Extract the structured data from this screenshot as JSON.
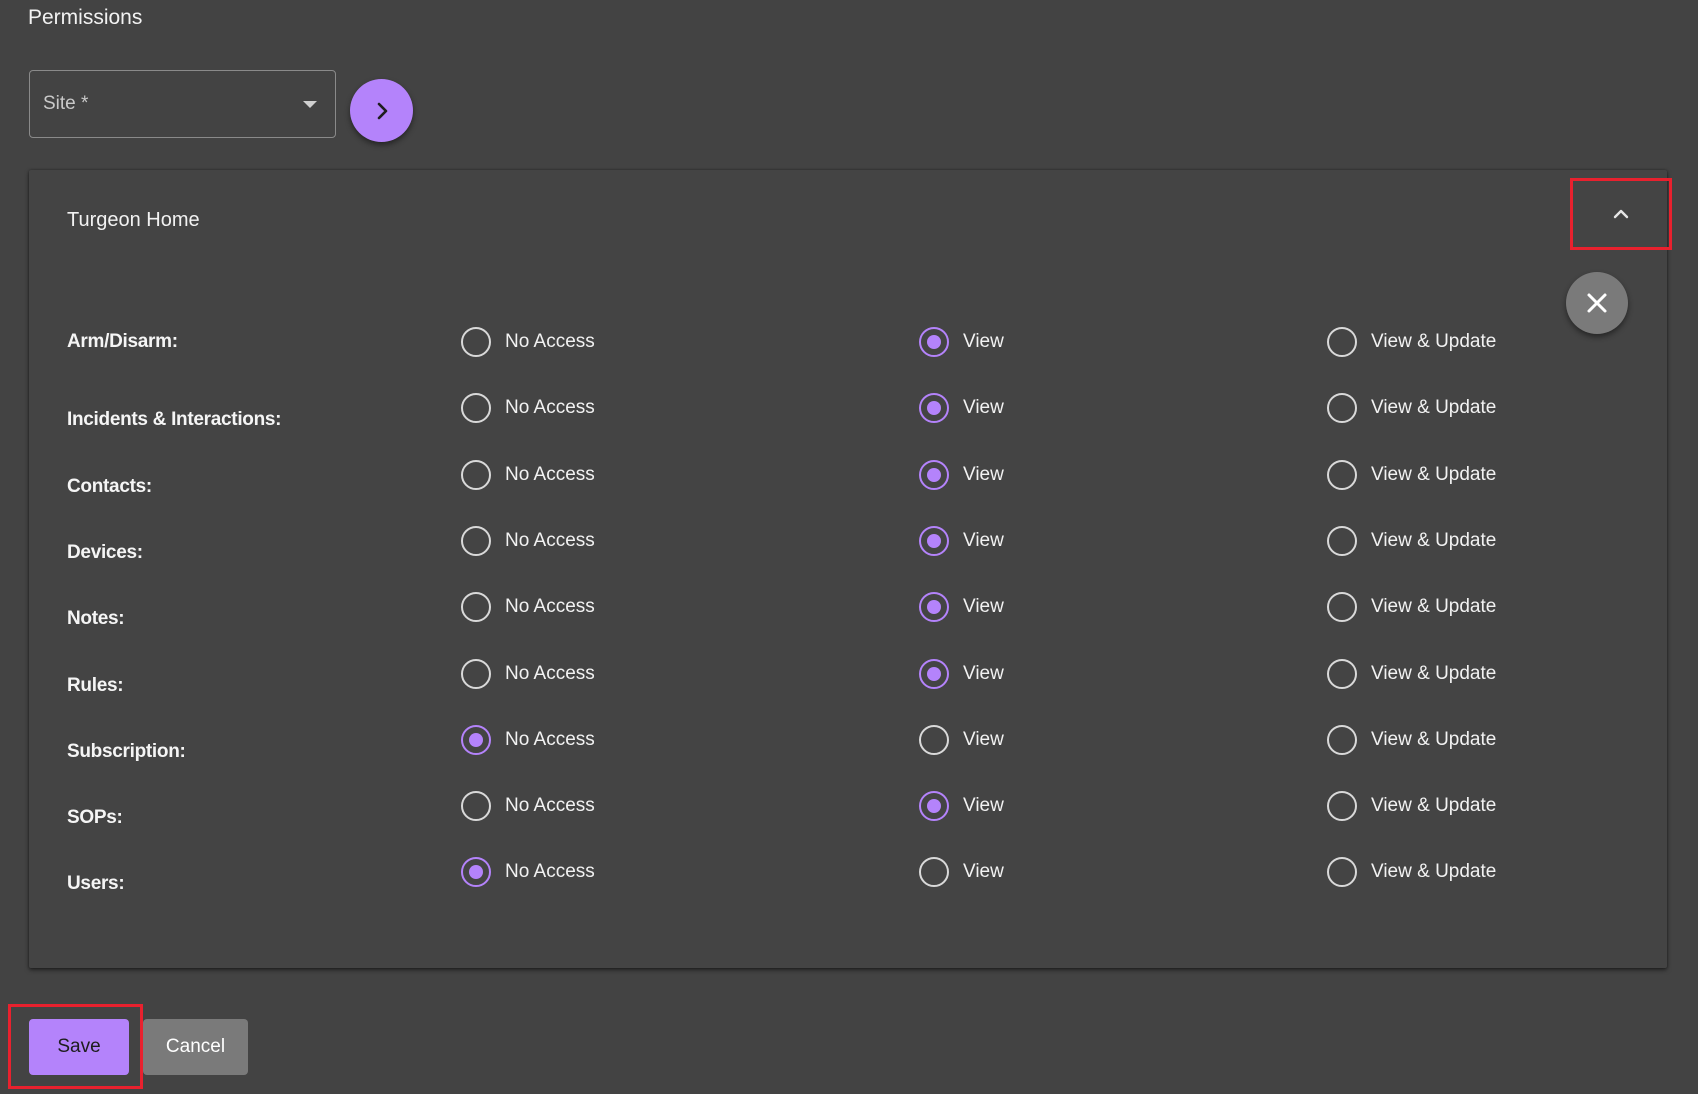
{
  "section": {
    "title": "Permissions"
  },
  "site_select": {
    "label": "Site *",
    "icon": "caret-down-icon"
  },
  "go_button": {
    "icon": "chevron-right-icon"
  },
  "card": {
    "title": "Turgeon Home",
    "collapse_icon": "chevron-up-icon",
    "remove_icon": "close-icon"
  },
  "options": [
    "No Access",
    "View",
    "View & Update"
  ],
  "permissions": [
    {
      "label": "Arm/Disarm:",
      "selected": "View"
    },
    {
      "label": "Incidents & Interactions:",
      "selected": "View"
    },
    {
      "label": "Contacts:",
      "selected": "View"
    },
    {
      "label": "Devices:",
      "selected": "View"
    },
    {
      "label": "Notes:",
      "selected": "View"
    },
    {
      "label": "Rules:",
      "selected": "View"
    },
    {
      "label": "Subscription:",
      "selected": "No Access"
    },
    {
      "label": "SOPs:",
      "selected": "View"
    },
    {
      "label": "Users:",
      "selected": "No Access"
    }
  ],
  "actions": {
    "save_label": "Save",
    "cancel_label": "Cancel"
  },
  "colors": {
    "accent": "#b483fb",
    "background": "#434343",
    "highlight": "#e8212e",
    "secondary_button": "#7a7a7a"
  }
}
